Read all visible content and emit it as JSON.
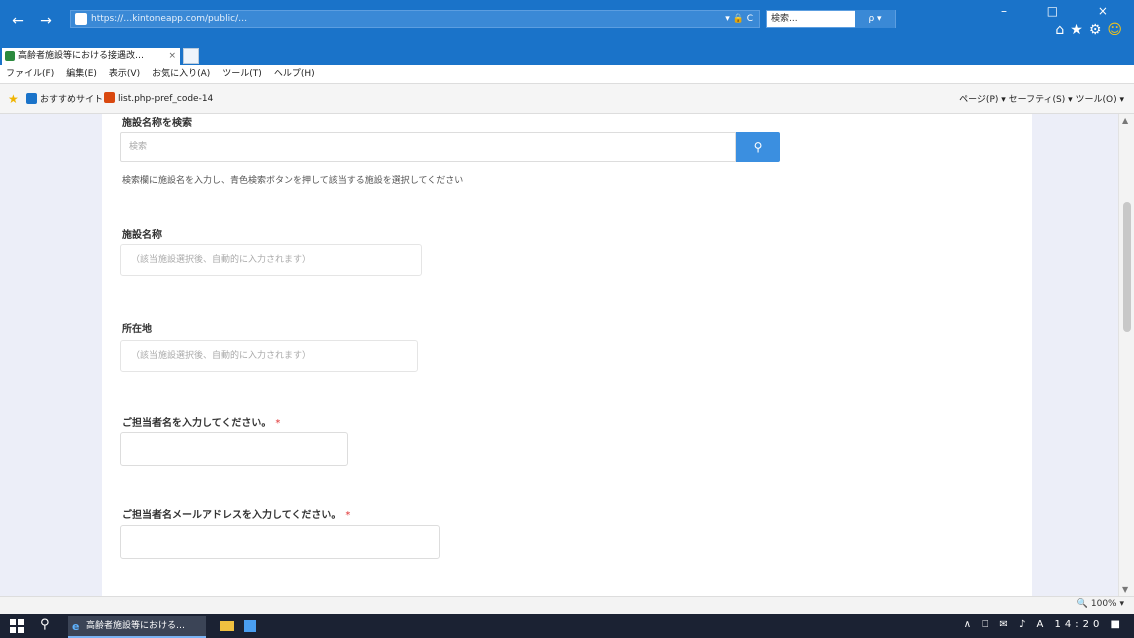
{
  "browser": {
    "address": "https://…kintoneapp.com/public/…",
    "address_controls": "▾ 🔒 C",
    "search_text": "検索...",
    "search_button": "ρ ▾",
    "tab_title": "高齢者施設等における接遇改…",
    "tab_close": "×",
    "window_controls": "– □ ×",
    "toolbar_icons": [
      "⌂",
      "★",
      "⚙",
      "☺"
    ],
    "menu": [
      "ファイル(F)",
      "編集(E)",
      "表示(V)",
      "お気に入り(A)",
      "ツール(T)",
      "ヘルプ(H)"
    ],
    "favorites": {
      "suggested_sites": "おすすめサイト ▾",
      "page_link": "list.php-pref_code-14"
    },
    "command_bar": "ページ(P) ▾  セーフティ(S) ▾  ツール(O) ▾",
    "zoom": "🔍 100% ▾"
  },
  "form": {
    "search_section_label": "施設名称を検索",
    "search_placeholder": "検索",
    "search_icon": "search-icon",
    "search_hint": "検索欄に施設名を入力し、青色検索ボタンを押して該当する施設を選択してください",
    "facility_name_label": "施設名称",
    "facility_name_placeholder": "（該当施設選択後、自動的に入力されます）",
    "address_label": "所在地",
    "address_placeholder": "（該当施設選択後、自動的に入力されます）",
    "contact_name_label": "ご担当者名を入力してください。",
    "contact_email_label": "ご担当者名メールアドレスを入力してください。",
    "required_mark": "*"
  },
  "taskbar": {
    "app_label": "高齢者施設等における…",
    "tray": "∧ ⎕ ✉ ♪ A 14:20 ■"
  },
  "colors": {
    "accent": "#3b8fe0",
    "titlebar": "#1a73c9",
    "page_background": "#eceef8",
    "required": "#e03131"
  }
}
